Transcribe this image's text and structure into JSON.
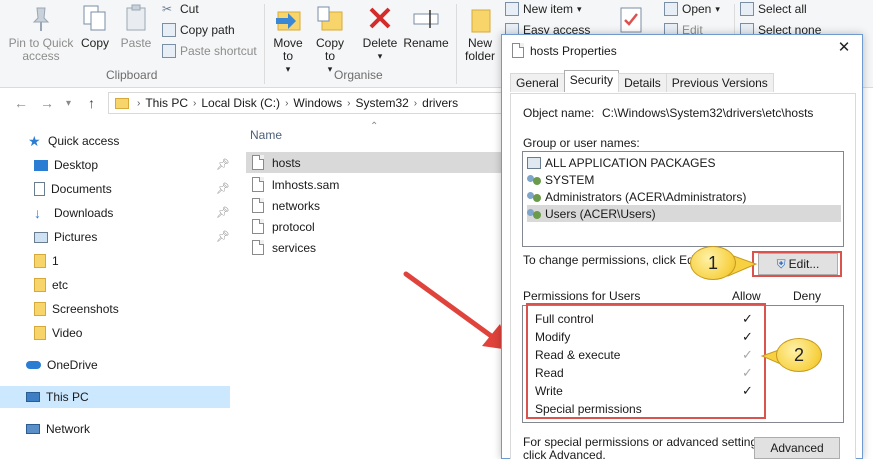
{
  "ribbon": {
    "clipboard": {
      "pin_label": "Pin to Quick access",
      "copy": "Copy",
      "paste": "Paste",
      "cut": "Cut",
      "copy_path": "Copy path",
      "paste_shortcut": "Paste shortcut",
      "group": "Clipboard"
    },
    "organise": {
      "move_to": "Move to",
      "copy_to": "Copy to",
      "delete": "Delete",
      "rename": "Rename",
      "group": "Organise"
    },
    "new": {
      "new_folder": "New folder",
      "new_item": "New item",
      "easy_access": "Easy access"
    },
    "open": {
      "open": "Open",
      "edit": "Edit"
    },
    "select": {
      "select_all": "Select all",
      "select_none": "Select none"
    }
  },
  "address": {
    "crumbs": [
      "This PC",
      "Local Disk (C:)",
      "Windows",
      "System32",
      "drivers"
    ]
  },
  "sidebar": {
    "items": [
      {
        "label": "Quick access"
      },
      {
        "label": "Desktop"
      },
      {
        "label": "Documents"
      },
      {
        "label": "Downloads"
      },
      {
        "label": "Pictures"
      },
      {
        "label": "1"
      },
      {
        "label": "etc"
      },
      {
        "label": "Screenshots"
      },
      {
        "label": "Video"
      },
      {
        "label": "OneDrive"
      },
      {
        "label": "This PC"
      },
      {
        "label": "Network"
      }
    ]
  },
  "files": {
    "column": "Name",
    "items": [
      "hosts",
      "lmhosts.sam",
      "networks",
      "protocol",
      "services"
    ]
  },
  "dialog": {
    "title": "hosts Properties",
    "tabs": [
      "General",
      "Security",
      "Details",
      "Previous Versions"
    ],
    "object_label": "Object name:",
    "object_value": "C:\\Windows\\System32\\drivers\\etc\\hosts",
    "groups_label": "Group or user names:",
    "groups": [
      "ALL APPLICATION PACKAGES",
      "SYSTEM",
      "Administrators (ACER\\Administrators)",
      "Users (ACER\\Users)"
    ],
    "change_text": "To change permissions, click Edit.",
    "edit_button": "Edit...",
    "perm_label": "Permissions for Users",
    "allow": "Allow",
    "deny": "Deny",
    "permissions": [
      {
        "name": "Full control",
        "allow": "✓"
      },
      {
        "name": "Modify",
        "allow": "✓"
      },
      {
        "name": "Read & execute",
        "allow": "✓"
      },
      {
        "name": "Read",
        "allow": "✓"
      },
      {
        "name": "Write",
        "allow": "✓"
      },
      {
        "name": "Special permissions",
        "allow": ""
      }
    ],
    "advanced_text_1": "For special permissions or advanced settings,",
    "advanced_text_2": "click Advanced.",
    "advanced_button": "Advanced"
  },
  "callouts": {
    "one": "1",
    "two": "2"
  },
  "colors": {
    "accent": "#0078d7",
    "callout_red": "#d9534f",
    "callout_yellow": "#f7d142"
  }
}
